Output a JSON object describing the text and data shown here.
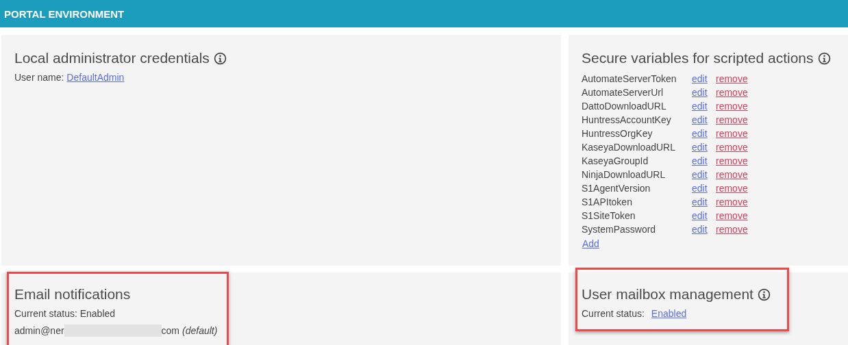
{
  "header": {
    "title": "PORTAL ENVIRONMENT"
  },
  "credentials": {
    "title": "Local administrator credentials",
    "info": true,
    "user_label": "User name:",
    "user_link": "DefaultAdmin"
  },
  "secure_variables": {
    "title": "Secure variables for scripted actions",
    "info": true,
    "items": [
      {
        "name": "AutomateServerToken",
        "edit": "edit",
        "remove": "remove"
      },
      {
        "name": "AutomateServerUrl",
        "edit": "edit",
        "remove": "remove"
      },
      {
        "name": "DattoDownloadURL",
        "edit": "edit",
        "remove": "remove"
      },
      {
        "name": "HuntressAccountKey",
        "edit": "edit",
        "remove": "remove"
      },
      {
        "name": "HuntressOrgKey",
        "edit": "edit",
        "remove": "remove"
      },
      {
        "name": "KaseyaDownloadURL",
        "edit": "edit",
        "remove": "remove"
      },
      {
        "name": "KaseyaGroupId",
        "edit": "edit",
        "remove": "remove"
      },
      {
        "name": "NinjaDownloadURL",
        "edit": "edit",
        "remove": "remove"
      },
      {
        "name": "S1AgentVersion",
        "edit": "edit",
        "remove": "remove"
      },
      {
        "name": "S1APItoken",
        "edit": "edit",
        "remove": "remove"
      },
      {
        "name": "S1SiteToken",
        "edit": "edit",
        "remove": "remove"
      },
      {
        "name": "SystemPassword",
        "edit": "edit",
        "remove": "remove"
      }
    ],
    "add": "Add"
  },
  "email_notifications": {
    "title": "Email notifications",
    "highlighted": true,
    "status": "Current status: Enabled",
    "email_start": "admin@ner",
    "email_end": "com",
    "email_note": "(default)"
  },
  "user_mailbox": {
    "title": "User mailbox management",
    "info": true,
    "highlighted": true,
    "status_label": "Current status:",
    "status_link": "Enabled"
  }
}
